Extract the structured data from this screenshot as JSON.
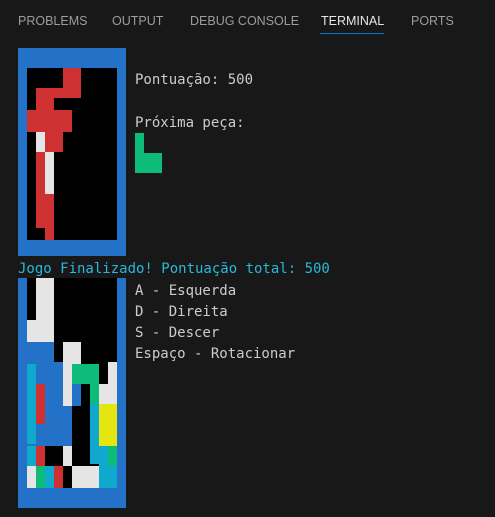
{
  "panel": {
    "tabs": [
      {
        "label": "PROBLEMS",
        "active": false
      },
      {
        "label": "OUTPUT",
        "active": false
      },
      {
        "label": "DEBUG CONSOLE",
        "active": false
      },
      {
        "label": "TERMINAL",
        "active": true
      },
      {
        "label": "PORTS",
        "active": false
      }
    ]
  },
  "terminal": {
    "score_line": "Pontuação: 500",
    "next_piece_label": "Próxima peça:",
    "game_over_line": "Jogo Finalizado! Pontuação total: 500",
    "controls": [
      "A - Esquerda",
      "D - Direita",
      "S - Descer",
      "Espaço - Rotacionar"
    ]
  },
  "colors": {
    "background": "#181818",
    "border_blue": "#2472c8",
    "red": "#cd3131",
    "white": "#e5e5e5",
    "green": "#0dbc79",
    "cyan": "#11a8cd",
    "yellow": "#e5e510",
    "black": "#000000",
    "game_over_text": "#29b8db"
  }
}
